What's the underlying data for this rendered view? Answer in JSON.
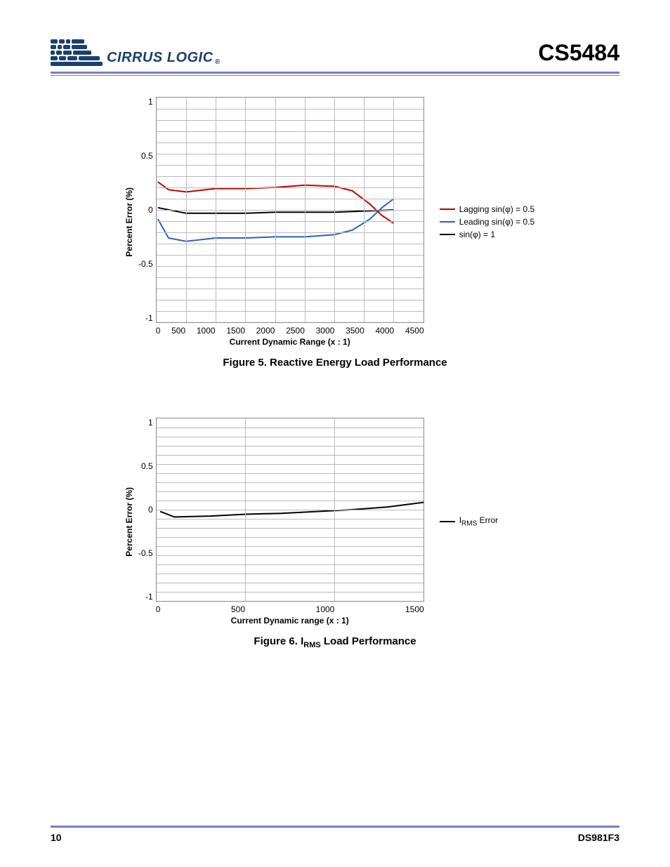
{
  "header": {
    "logo_text": "CIRRUS LOGIC",
    "logo_r": "®",
    "part_number": "CS5484"
  },
  "chart_data": [
    {
      "type": "line",
      "title": "",
      "xlabel": "Current Dynamic Range (x : 1)",
      "ylabel": "Percent Error (%)",
      "xlim": [
        0,
        4500
      ],
      "ylim": [
        -1,
        1
      ],
      "xticks": [
        "0",
        "500",
        "1000",
        "1500",
        "2000",
        "2500",
        "3000",
        "3500",
        "4000",
        "4500"
      ],
      "yticks": [
        "1",
        "0.5",
        "0",
        "-0.5",
        "-1"
      ],
      "series": [
        {
          "name": "Lagging sin(φ) = 0.5",
          "color": "#c00000",
          "x": [
            20,
            200,
            500,
            1000,
            1500,
            2000,
            2500,
            3000,
            3300,
            3600,
            3800,
            4000
          ],
          "y": [
            0.25,
            0.18,
            0.16,
            0.19,
            0.19,
            0.2,
            0.22,
            0.21,
            0.17,
            0.05,
            -0.05,
            -0.12
          ]
        },
        {
          "name": "Leading sin(φ) = 0.5",
          "color": "#2f5fbf",
          "x": [
            20,
            200,
            500,
            1000,
            1500,
            2000,
            2500,
            3000,
            3300,
            3600,
            3800,
            4000
          ],
          "y": [
            -0.08,
            -0.25,
            -0.28,
            -0.25,
            -0.25,
            -0.24,
            -0.24,
            -0.22,
            -0.18,
            -0.08,
            0.02,
            0.1
          ]
        },
        {
          "name": "sin(φ) = 1",
          "color": "#000000",
          "x": [
            20,
            500,
            1000,
            1500,
            2000,
            2500,
            3000,
            3500,
            4000
          ],
          "y": [
            0.02,
            -0.03,
            -0.03,
            -0.03,
            -0.02,
            -0.02,
            -0.02,
            -0.01,
            0.0
          ]
        }
      ]
    },
    {
      "type": "line",
      "title": "",
      "xlabel": "Current Dynamic range (x : 1)",
      "ylabel": "Percent Error (%)",
      "xlim": [
        0,
        1500
      ],
      "ylim": [
        -1,
        1
      ],
      "xticks": [
        "0",
        "500",
        "1000",
        "1500"
      ],
      "yticks": [
        "1",
        "0.5",
        "0",
        "-0.5",
        "-1"
      ],
      "series": [
        {
          "name": "I_RMS Error",
          "color": "#000000",
          "x": [
            20,
            100,
            300,
            500,
            700,
            900,
            1100,
            1300,
            1500
          ],
          "y": [
            -0.02,
            -0.08,
            -0.07,
            -0.05,
            -0.04,
            -0.02,
            0.0,
            0.03,
            0.08
          ]
        }
      ]
    }
  ],
  "captions": {
    "fig5": "Figure 5.  Reactive Energy Load Performance",
    "fig6_pre": "Figure 6.  I",
    "fig6_sub": "RMS",
    "fig6_post": " Load Performance"
  },
  "legend1": {
    "s0": "Lagging sin(φ) = 0.5",
    "s1": "Leading sin(φ) = 0.5",
    "s2": "sin(φ) = 1"
  },
  "legend2_pre": "I",
  "legend2_sub": "RMS",
  "legend2_post": " Error",
  "footer": {
    "page": "10",
    "doc": "DS981F3"
  }
}
